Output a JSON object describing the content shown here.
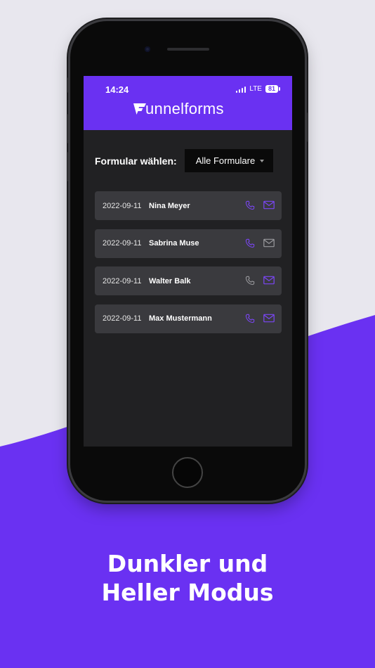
{
  "status_bar": {
    "time": "14:24",
    "network": "LTE",
    "battery": "81"
  },
  "app": {
    "brand_name": "unnelforms",
    "brand_color": "#6a31f2",
    "filter": {
      "label": "Formular wählen:",
      "selected": "Alle Formulare"
    },
    "submissions": [
      {
        "date": "2022-09-11",
        "name": "Nina Meyer",
        "phone_active": true,
        "mail_active": true
      },
      {
        "date": "2022-09-11",
        "name": "Sabrina Muse",
        "phone_active": true,
        "mail_active": false
      },
      {
        "date": "2022-09-11",
        "name": "Walter Balk",
        "phone_active": false,
        "mail_active": true
      },
      {
        "date": "2022-09-11",
        "name": "Max Mustermann",
        "phone_active": true,
        "mail_active": true
      }
    ],
    "icons": {
      "phone": "phone-icon",
      "mail": "mail-icon"
    },
    "colors": {
      "active_icon": "#7b46f5",
      "inactive_icon": "#9a9a9e"
    }
  },
  "promo": {
    "headline_line1": "Dunkler und",
    "headline_line2": "Heller Modus"
  }
}
